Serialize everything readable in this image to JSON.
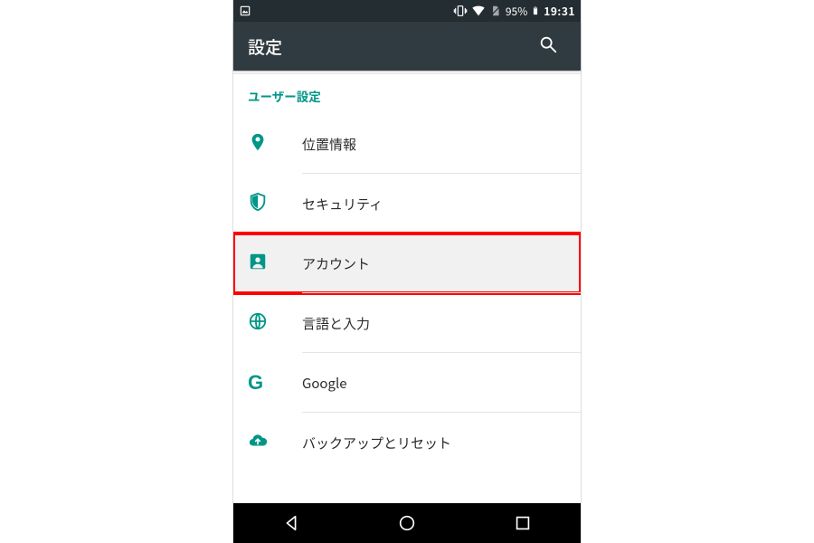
{
  "statusbar": {
    "battery_pct": "95%",
    "time": "19:31"
  },
  "appbar": {
    "title": "設定"
  },
  "section": {
    "header": "ユーザー設定",
    "items": [
      {
        "label": "位置情報"
      },
      {
        "label": "セキュリティ"
      },
      {
        "label": "アカウント"
      },
      {
        "label": "言語と入力"
      },
      {
        "label": "Google"
      },
      {
        "label": "バックアップとリセット"
      }
    ]
  },
  "highlighted_index": 2
}
